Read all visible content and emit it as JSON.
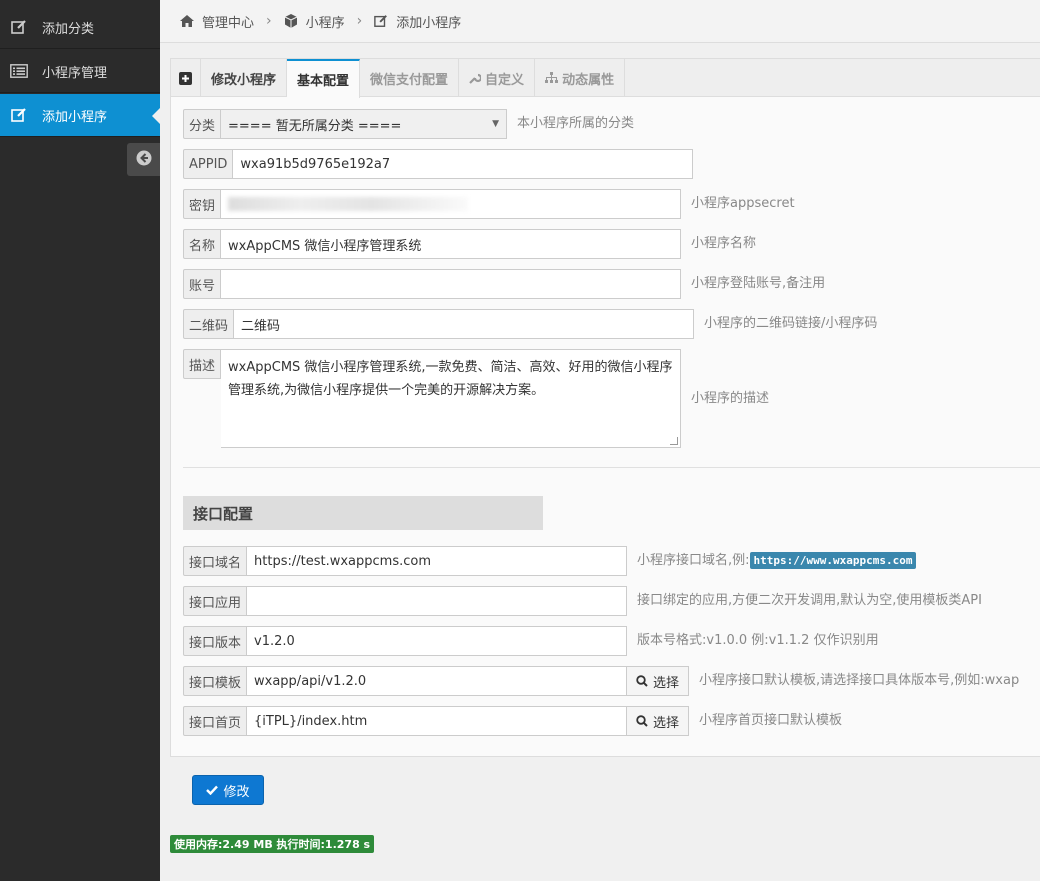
{
  "sidebar": {
    "items": [
      {
        "label": "添加分类",
        "icon": "edit-icon"
      },
      {
        "label": "小程序管理",
        "icon": "list-icon"
      },
      {
        "label": "添加小程序",
        "icon": "edit-icon",
        "active": true
      }
    ],
    "collapse_icon": "arrow-left-circle-icon"
  },
  "breadcrumb": {
    "items": [
      {
        "label": "管理中心",
        "icon": "home-icon"
      },
      {
        "label": "小程序",
        "icon": "cube-icon"
      },
      {
        "label": "添加小程序",
        "icon": "edit-icon"
      }
    ]
  },
  "tabs": [
    {
      "label": "",
      "icon": "plus-square-icon"
    },
    {
      "label": "修改小程序"
    },
    {
      "label": "基本配置",
      "active": true
    },
    {
      "label": "微信支付配置",
      "disabled": true
    },
    {
      "label": "自定义",
      "icon": "wrench-icon",
      "disabled": true
    },
    {
      "label": "动态属性",
      "icon": "sitemap-icon",
      "disabled": true
    }
  ],
  "form": {
    "category": {
      "label": "分类",
      "value": "==== 暂无所属分类 ====",
      "hint": "本小程序所属的分类"
    },
    "appid": {
      "label": "APPID",
      "value": "wxa91b5d9765e192a7"
    },
    "secret": {
      "label": "密钥",
      "hint": "小程序appsecret"
    },
    "name": {
      "label": "名称",
      "value": "wxAppCMS 微信小程序管理系统",
      "hint": "小程序名称"
    },
    "account": {
      "label": "账号",
      "value": "",
      "hint": "小程序登陆账号,备注用"
    },
    "qrcode": {
      "label": "二维码",
      "value": "二维码",
      "hint": "小程序的二维码链接/小程序码"
    },
    "desc": {
      "label": "描述",
      "value": "wxAppCMS 微信小程序管理系统,一款免费、简洁、高效、好用的微信小程序管理系统,为微信小程序提供一个完美的开源解决方案。",
      "hint": "小程序的描述"
    }
  },
  "api_section": {
    "title": "接口配置",
    "domain": {
      "label": "接口域名",
      "value": "https://test.wxappcms.com",
      "hint": "小程序接口域名,例:",
      "example": "https://www.wxappcms.com"
    },
    "app": {
      "label": "接口应用",
      "value": "",
      "hint": "接口绑定的应用,方便二次开发调用,默认为空,使用模板类API"
    },
    "version": {
      "label": "接口版本",
      "value": "v1.2.0",
      "hint": "版本号格式:v1.0.0 例:v1.1.2 仅作识别用"
    },
    "template": {
      "label": "接口模板",
      "value": "wxapp/api/v1.2.0",
      "button": "选择",
      "hint": "小程序接口默认模板,请选择接口具体版本号,例如:wxap"
    },
    "home": {
      "label": "接口首页",
      "value": "{iTPL}/index.htm",
      "button": "选择",
      "hint": "小程序首页接口默认模板"
    }
  },
  "submit_label": "修改",
  "footer": "使用内存:2.49 MB 执行时间:1.278 s",
  "colors": {
    "accent": "#0e90d2",
    "sidebar": "#2b2b2b",
    "footer_badge": "#2e8b3a"
  }
}
